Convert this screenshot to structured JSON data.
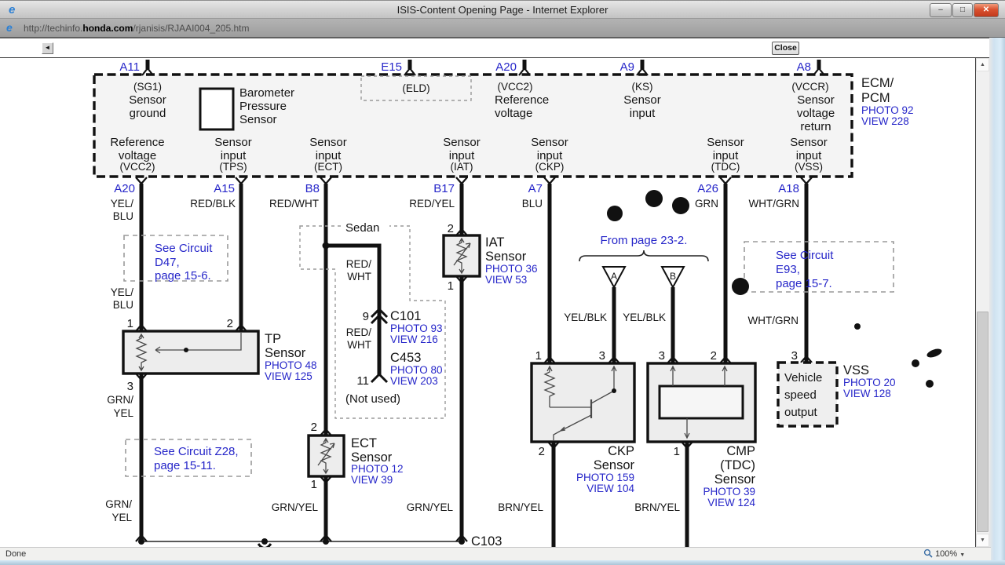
{
  "chrome": {
    "title": "ISIS-Content Opening Page - Internet Explorer",
    "min": "–",
    "max": "□",
    "x": "✕",
    "url_prefix": "http://techinfo.",
    "url_domain": "honda.com",
    "url_path": "/rjanisis/RJAAI004_205.htm",
    "back_glyph": "◄",
    "close_button": "Close",
    "status_text": "Done",
    "zoom_level": "100%",
    "scroll_up": "▲",
    "scroll_down": "▼",
    "zoom_caret": "▼"
  },
  "colors": {
    "link_blue": "#2626c9",
    "diagram_black": "#141414"
  },
  "ecm": {
    "pin_a11": "A11",
    "pin_e15": "E15",
    "pin_a20t": "A20",
    "pin_a9": "A9",
    "pin_a8": "A8",
    "sg1_code": "(SG1)",
    "sg1_l1": "Sensor",
    "sg1_l2": "ground",
    "baro_l1": "Barometer",
    "baro_l2": "Pressure",
    "baro_l3": "Sensor",
    "eld_code": "(ELD)",
    "vcc2_code": "(VCC2)",
    "vcc2_l1": "Reference",
    "vcc2_l2": "voltage",
    "ks_code": "(KS)",
    "ks_l1": "Sensor",
    "ks_l2": "input",
    "vccr_code": "(VCCR)",
    "vccr_l1": "Sensor",
    "vccr_l2": "voltage",
    "vccr_l3": "return",
    "name_l1": "ECM/",
    "name_l2": "PCM",
    "photo": "PHOTO 92",
    "view": "VIEW 228",
    "col1_l1": "Reference",
    "col1_l2": "voltage",
    "col1_code": "(VCC2)",
    "col2_l1": "Sensor",
    "col2_l2": "input",
    "col2_code": "(TPS)",
    "col3_l1": "Sensor",
    "col3_l2": "input",
    "col3_code": "(ECT)",
    "col4_l1": "Sensor",
    "col4_l2": "input",
    "col4_code": "(IAT)",
    "col5_l1": "Sensor",
    "col5_l2": "input",
    "col5_code": "(CKP)",
    "col6_l1": "Sensor",
    "col6_l2": "input",
    "col6_code": "(TDC)",
    "col7_l1": "Sensor",
    "col7_l2": "input",
    "col7_code": "(VSS)",
    "pin_a20": "A20",
    "pin_a15": "A15",
    "pin_b8": "B8",
    "pin_b17": "B17",
    "pin_a7": "A7",
    "pin_a26": "A26",
    "pin_a18": "A18"
  },
  "wires": {
    "yel1": "YEL/",
    "blu1": "BLU",
    "redblk": "RED/BLK",
    "redwht": "RED/WHT",
    "redyel": "RED/YEL",
    "blu": "BLU",
    "grn": "GRN",
    "whtgrn": "WHT/GRN",
    "yel2": "YEL/",
    "blu2": "BLU",
    "red1": "RED/",
    "wht1": "WHT",
    "red2": "RED/",
    "wht2": "WHT",
    "grn1": "GRN/",
    "yel3": "YEL",
    "yelblk_a": "YEL/BLK",
    "yelblk_b": "YEL/BLK",
    "whtgrn2": "WHT/GRN",
    "grnyel_b1a": "GRN/",
    "grnyel_b1b": "YEL",
    "grnyel_b2": "GRN/YEL",
    "grnyel_b3": "GRN/YEL",
    "brnyel_1": "BRN/YEL",
    "brnyel_2": "BRN/YEL"
  },
  "notes": {
    "d47_l1": "See Circuit",
    "d47_l2": "D47,",
    "d47_l3": "page 15-6.",
    "z28_l1": "See Circuit Z28,",
    "z28_l2": "page 15-11.",
    "e93_l1": "See Circuit",
    "e93_l2": "E93,",
    "e93_l3": "page 15-7.",
    "from_page": "From page 23-2.",
    "sedan": "Sedan",
    "not_used": "(Not used)",
    "tri_a": "A",
    "tri_b": "B"
  },
  "iat": {
    "pin2": "2",
    "pin1": "1",
    "name": "IAT",
    "name2": "Sensor",
    "photo": "PHOTO 36",
    "view": "VIEW 53"
  },
  "tp": {
    "pin1": "1",
    "pin2": "2",
    "pin3": "3",
    "name": "TP",
    "name2": "Sensor",
    "photo": "PHOTO 48",
    "view": "VIEW 125"
  },
  "ect": {
    "pin2": "2",
    "pin1": "1",
    "name": "ECT",
    "name2": "Sensor",
    "photo": "PHOTO 12",
    "view": "VIEW 39"
  },
  "ckp": {
    "pin1": "1",
    "pin3": "3",
    "pin2": "2",
    "name": "CKP",
    "name2": "Sensor",
    "photo": "PHOTO 159",
    "view": "VIEW 104"
  },
  "cmp": {
    "pin3": "3",
    "pin2": "2",
    "pin1": "1",
    "name": "CMP",
    "name2": "(TDC)",
    "name3": "Sensor",
    "photo": "PHOTO 39",
    "view": "VIEW 124"
  },
  "vss": {
    "pin3": "3",
    "box_l1": "Vehicle",
    "box_l2": "speed",
    "box_l3": "output",
    "name": "VSS",
    "photo": "PHOTO 20",
    "view": "VIEW 128"
  },
  "conn": {
    "c101_pin": "9",
    "c101": "C101",
    "c101_photo": "PHOTO 93",
    "c101_view": "VIEW 216",
    "c453_pin": "11",
    "c453": "C453",
    "c453_photo": "PHOTO 80",
    "c453_view": "VIEW 203",
    "c103": "C103"
  }
}
